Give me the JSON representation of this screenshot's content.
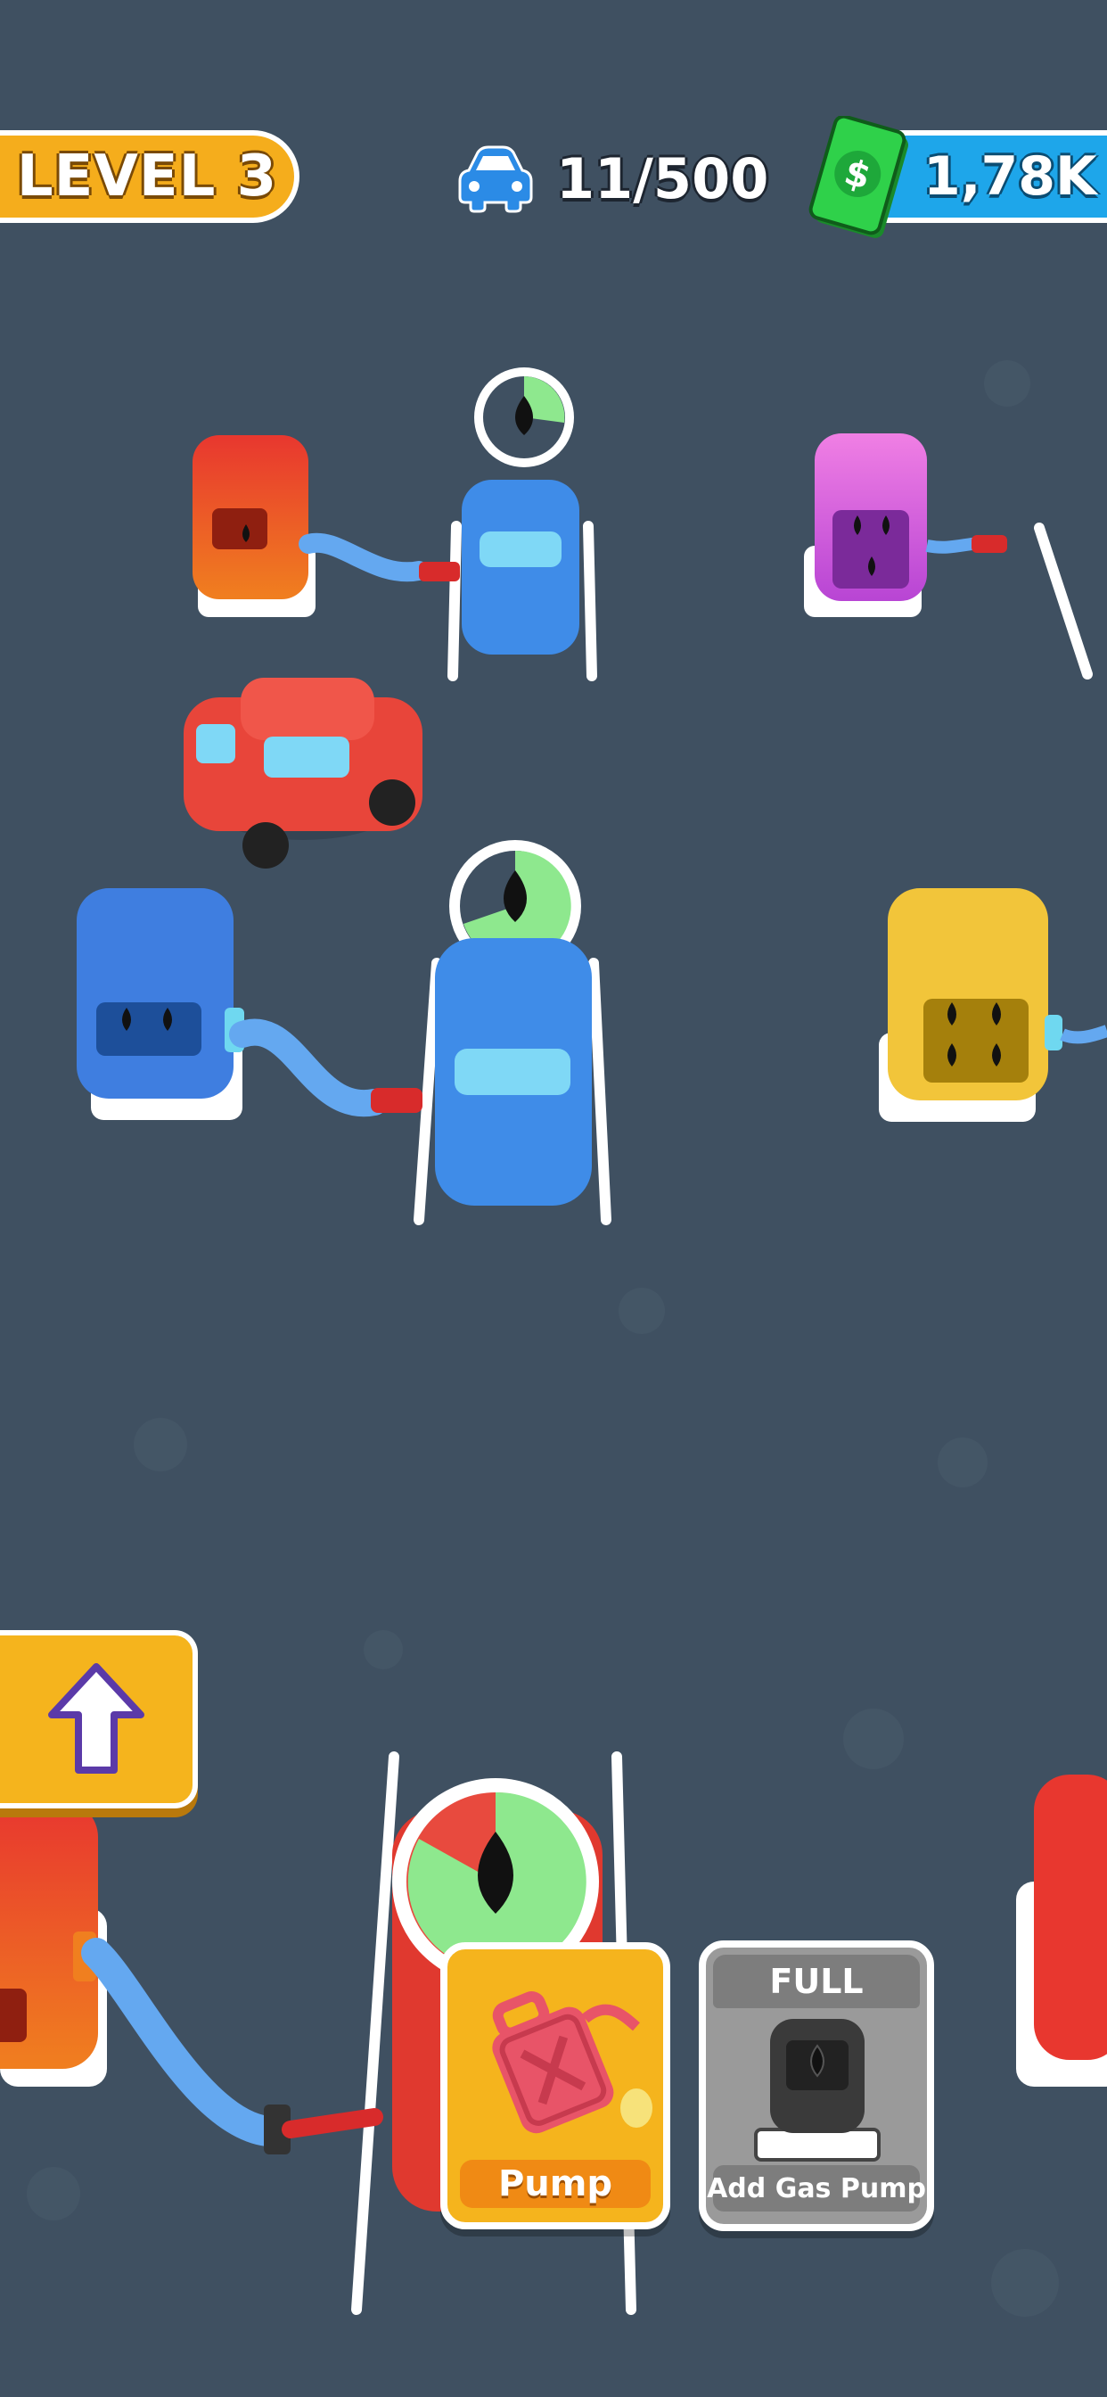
{
  "hud": {
    "level_label": "LEVEL 3",
    "cars_counter": "11/500",
    "money": "1,78K",
    "car_icon": "car-icon",
    "money_icon": "dollar-bill-icon"
  },
  "actions": {
    "upgrade_icon": "arrow-up-icon",
    "pump": {
      "label": "Pump",
      "icon": "gas-can-icon"
    },
    "add_gas_pump": {
      "status": "FULL",
      "label": "Add Gas Pump",
      "icon": "gas-pump-icon"
    }
  },
  "scene": {
    "pumps": [
      {
        "color": "red",
        "fuel_drops": 1
      },
      {
        "color": "purple",
        "fuel_drops": 3
      },
      {
        "color": "blue",
        "fuel_drops": 2
      },
      {
        "color": "yellow",
        "fuel_drops": 4
      },
      {
        "color": "red",
        "fuel_drops": 1
      }
    ],
    "fuel_gauges": [
      {
        "fill_fraction": 0.25
      },
      {
        "fill_fraction": 0.6
      },
      {
        "fill_fraction": 0.85
      }
    ]
  },
  "colors": {
    "ground": "#3f5061",
    "hud_orange": "#f5ad1c",
    "hud_blue": "#1ea6ea",
    "car_blue": "#3f8ce8",
    "car_red": "#e8453a",
    "gauge_green": "#8ee88e"
  }
}
